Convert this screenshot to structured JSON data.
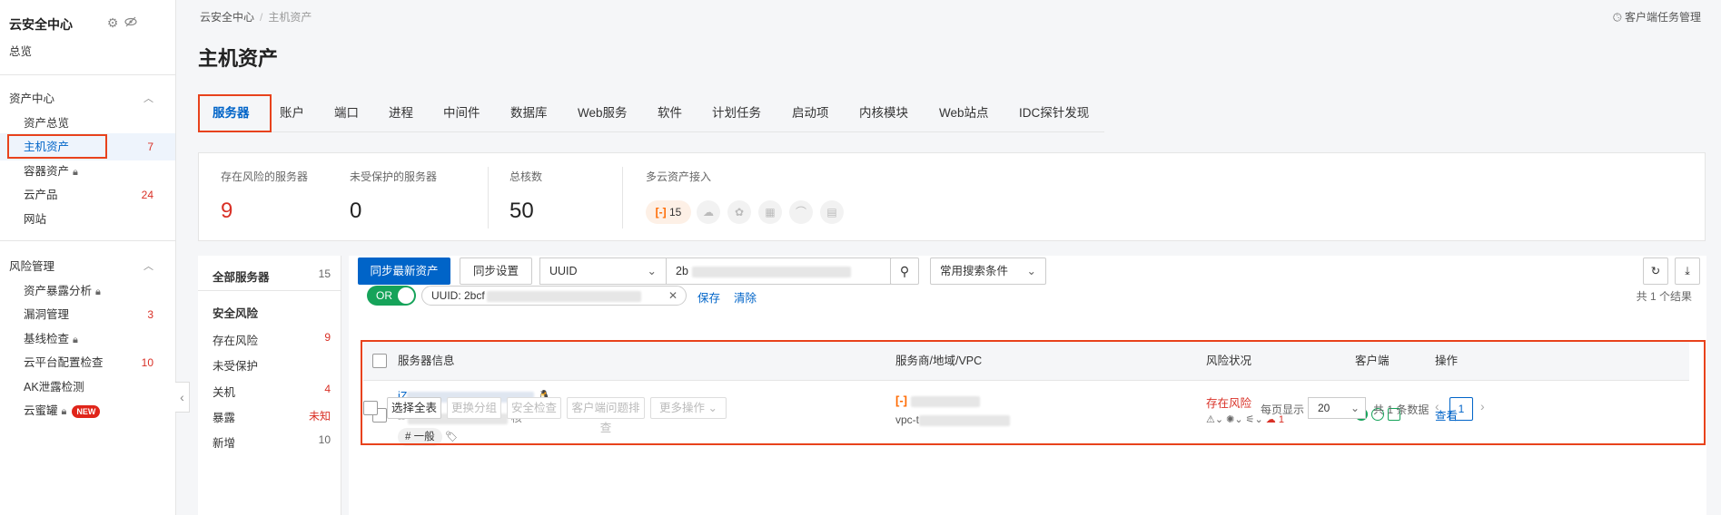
{
  "sidebar": {
    "title": "云安全中心",
    "overview": "总览",
    "asset_center": "资产中心",
    "asset_items": [
      {
        "label": "资产总览",
        "count": ""
      },
      {
        "label": "主机资产",
        "count": "7"
      },
      {
        "label": "容器资产",
        "count": ""
      },
      {
        "label": "云产品",
        "count": "24"
      },
      {
        "label": "网站",
        "count": ""
      }
    ],
    "risk_mgmt": "风险管理",
    "risk_items": [
      {
        "label": "资产暴露分析",
        "count": ""
      },
      {
        "label": "漏洞管理",
        "count": "3"
      },
      {
        "label": "基线检查",
        "count": ""
      },
      {
        "label": "云平台配置检查",
        "count": "10"
      },
      {
        "label": "AK泄露检测",
        "count": ""
      },
      {
        "label": "云蜜罐",
        "count": ""
      }
    ],
    "new_badge": "NEW"
  },
  "header": {
    "breadcrumb": [
      "云安全中心",
      "主机资产"
    ],
    "task_mgr": "客户端任务管理",
    "page_title": "主机资产"
  },
  "tabs": [
    "服务器",
    "账户",
    "端口",
    "进程",
    "中间件",
    "数据库",
    "Web服务",
    "软件",
    "计划任务",
    "启动项",
    "内核模块",
    "Web站点",
    "IDC探针发现"
  ],
  "stats": {
    "at_risk_label": "存在风险的服务器",
    "at_risk_value": "9",
    "unprotected_label": "未受保护的服务器",
    "unprotected_value": "0",
    "cores_label": "总核数",
    "cores_value": "50",
    "multicloud_label": "多云资产接入",
    "aliyun_count": "15"
  },
  "filter": {
    "all_label": "全部服务器",
    "all_count": "15",
    "security_risk": "安全风险",
    "items": [
      {
        "label": "存在风险",
        "count": "9"
      },
      {
        "label": "未受保护",
        "count": ""
      },
      {
        "label": "关机",
        "count": "4"
      },
      {
        "label": "暴露",
        "count": "未知"
      },
      {
        "label": "新增",
        "count": "10"
      }
    ]
  },
  "toolbar": {
    "sync_latest": "同步最新资产",
    "sync_settings": "同步设置",
    "search_field": "UUID",
    "search_value": "2b",
    "common_search": "常用搜索条件",
    "toggle_label": "OR",
    "chip": "UUID: 2bcf",
    "save": "保存",
    "clear": "清除",
    "result_count": "共 1 个结果"
  },
  "table": {
    "headers": [
      "服务器信息",
      "服务商/地域/VPC",
      "风险状况",
      "客户端",
      "操作"
    ],
    "row": {
      "name_prefix": "iZ",
      "ip_prefix": "--",
      "cores_suffix": "核",
      "group_tag": "# 一般",
      "vpc_prefix": "vpc-t",
      "risk_status": "存在风险",
      "alert_count": "1",
      "action": "查看"
    }
  },
  "footer": {
    "select_all": "选择全表",
    "change_group": "更换分组",
    "security_check": "安全检查",
    "client_troubleshoot": "客户端问题排查",
    "more_ops": "更多操作",
    "per_page_label": "每页显示",
    "per_page": "20",
    "total": "共 1 条数据",
    "page": "1"
  },
  "colors": {
    "primary": "#0064c8",
    "danger": "#d93026",
    "highlight": "#e8421c",
    "toggle": "#16a35a"
  }
}
